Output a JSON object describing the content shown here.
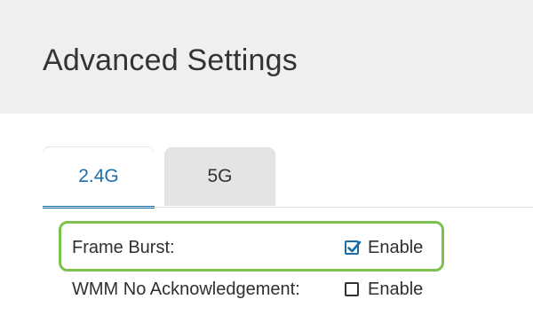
{
  "header": {
    "title": "Advanced Settings"
  },
  "tabs": [
    {
      "label": "2.4G",
      "active": true
    },
    {
      "label": "5G",
      "active": false
    }
  ],
  "settings": [
    {
      "label": "Frame Burst:",
      "control_label": "Enable",
      "checked": true,
      "highlighted": true
    },
    {
      "label": "WMM No Acknowledgement:",
      "control_label": "Enable",
      "checked": false,
      "highlighted": false
    }
  ],
  "colors": {
    "accent": "#1b6fa8",
    "highlight": "#7cc14e",
    "header_bg": "#efefef",
    "inactive_tab_bg": "#e4e4e4"
  },
  "icons": {
    "checked": "checkbox-checked-icon",
    "unchecked": "checkbox-unchecked-icon"
  }
}
